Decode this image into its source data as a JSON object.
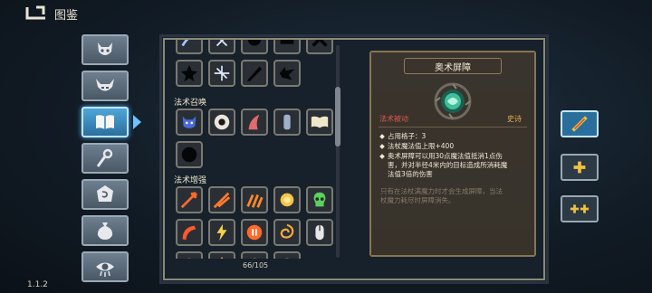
{
  "header": {
    "title": "图鉴"
  },
  "grid": {
    "sections": [
      {
        "label": "法术召唤"
      },
      {
        "label": "法术增强"
      }
    ],
    "count": "66/105"
  },
  "detail": {
    "title": "奥术屏障",
    "type": "法术被动",
    "rarity": "史诗",
    "lines": [
      "占用格子：3",
      "法杖魔法值上限+400",
      "奥术屏障可以用30点魔法值抵消1点伤",
      "害，并对半径4米内的目标造成所消耗魔",
      "法值3倍的伤害"
    ],
    "note": [
      "只有在法杖满魔力时才会生成屏障，当法",
      "杖魔力耗尽时屏障消失。"
    ]
  },
  "version": "1.1.2",
  "colors": {
    "accent": "#4fa6d8",
    "epic": "#e0b14a",
    "passive": "#e05a4a"
  }
}
